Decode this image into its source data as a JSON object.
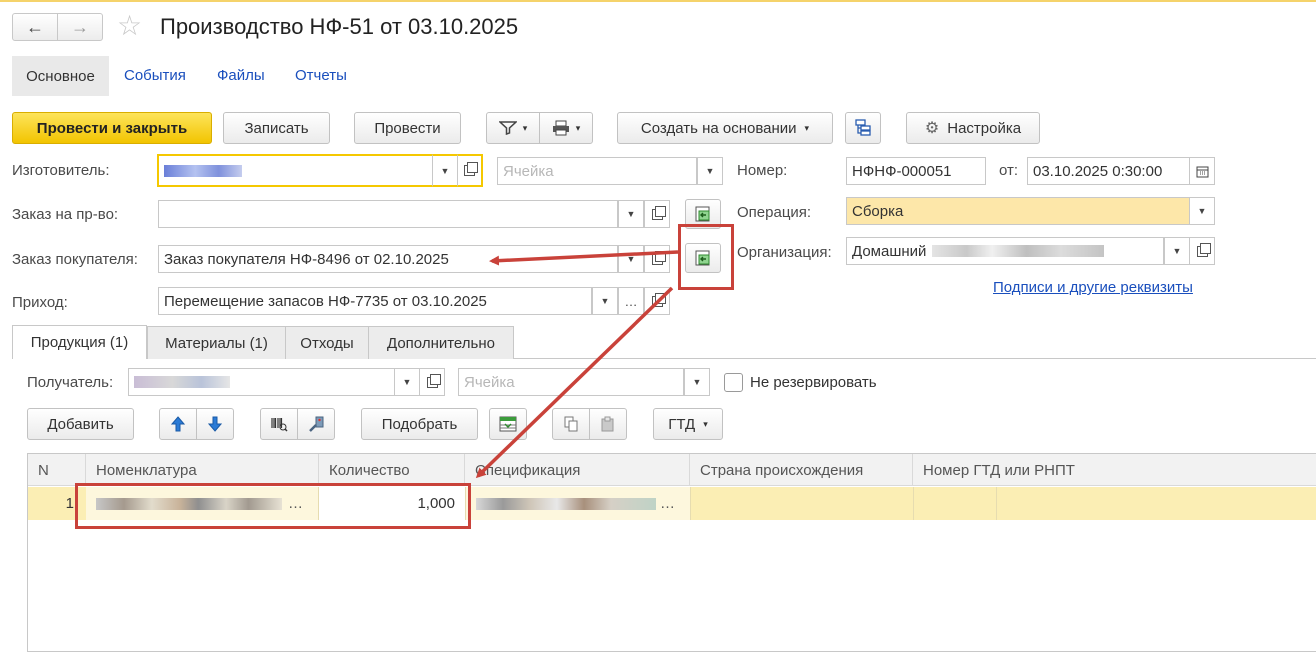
{
  "window": {
    "title": "Производство НФ-51 от 03.10.2025",
    "back_icon": "←",
    "forward_icon": "→",
    "star_icon": "☆"
  },
  "nav": {
    "main": "Основное",
    "events": "События",
    "files": "Файлы",
    "reports": "Отчеты"
  },
  "toolbar": {
    "post_close": "Провести и закрыть",
    "save": "Записать",
    "post": "Провести",
    "create_based": "Создать на основании",
    "settings": "Настройка"
  },
  "header": {
    "manufacturer_label": "Изготовитель:",
    "manufacturer_value": "",
    "cell_placeholder": "Ячейка",
    "production_order_label": "Заказ на пр-во:",
    "production_order_value": "",
    "customer_order_label": "Заказ покупателя:",
    "customer_order_value": "Заказ покупателя НФ-8496 от 02.10.2025",
    "receipt_label": "Приход:",
    "receipt_value": "Перемещение запасов НФ-7735 от 03.10.2025",
    "number_label": "Номер:",
    "number_value": "НФНФ-000051",
    "date_label": "от:",
    "date_value": "03.10.2025  0:30:00",
    "operation_label": "Операция:",
    "operation_value": "Сборка",
    "organization_label": "Организация:",
    "organization_value": "Домашний",
    "signatures_link": "Подписи и другие реквизиты"
  },
  "tabs": [
    "Продукция (1)",
    "Материалы (1)",
    "Отходы",
    "Дополнительно"
  ],
  "products": {
    "recipient_label": "Получатель:",
    "cell_placeholder": "Ячейка",
    "no_reserve_label": "Не резервировать",
    "add_button": "Добавить",
    "pick_button": "Подобрать",
    "gtd_button": "ГТД"
  },
  "table": {
    "columns": [
      "N",
      "Номенклатура",
      "Количество",
      "Спецификация",
      "Страна происхождения",
      "Номер ГТД или РНПТ"
    ],
    "rows": [
      {
        "n": "1",
        "nomenclature": "…",
        "quantity": "1,000",
        "specification": "…",
        "country": "",
        "gtd": ""
      }
    ]
  },
  "colors": {
    "accent_yellow": "#f5c800",
    "selected_row": "#fbeeb4",
    "operation_field": "#fde7a9",
    "annotation_red": "#c9423a",
    "link_blue": "#1a4fbd"
  }
}
